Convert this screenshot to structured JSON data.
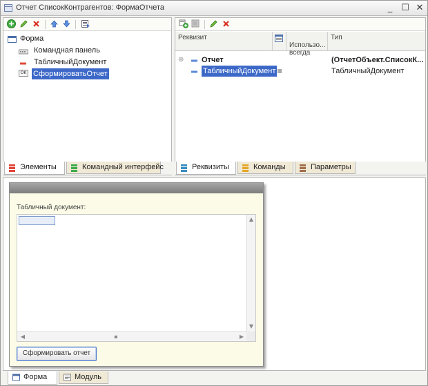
{
  "window": {
    "title": "Отчет СписокКонтрагентов: ФормаОтчета",
    "minimize_glyph": "_",
    "maximize_glyph": "☐",
    "close_glyph": "✕"
  },
  "left_pane": {
    "toolbar_icons": [
      "add-icon",
      "edit-icon",
      "delete-icon",
      "move-up-icon",
      "move-down-icon",
      "properties-icon"
    ],
    "tree": [
      {
        "label": "Форма",
        "icon": "form-icon",
        "selected": false
      },
      {
        "label": "Командная панель",
        "icon": "command-panel-icon",
        "selected": false
      },
      {
        "label": "ТабличныйДокумент",
        "icon": "spreadsheet-field-icon",
        "selected": false
      },
      {
        "label": "СформироватьОтчет",
        "icon": "ok-button-icon",
        "selected": true
      }
    ],
    "ok_badge": "OK",
    "tabs": [
      {
        "label": "Элементы",
        "active": true
      },
      {
        "label": "Командный интерфейс",
        "active": false
      }
    ]
  },
  "right_pane": {
    "toolbar_icons": [
      "add-attribute-icon",
      "add-column-icon",
      "edit-icon",
      "delete-icon"
    ],
    "columns": {
      "attribute": "Реквизит",
      "used_always": "Использо...\nвсегда",
      "type": "Тип"
    },
    "rows": [
      {
        "expander": "⊕",
        "name": "Отчет",
        "type": "(ОтчетОбъект.СписокК...",
        "bold": true,
        "selected": false
      },
      {
        "expander": "",
        "name": "ТабличныйДокумент",
        "type": "ТабличныйДокумент",
        "bold": false,
        "selected": true
      }
    ],
    "tabs": [
      {
        "label": "Реквизиты",
        "active": true
      },
      {
        "label": "Команды",
        "active": false
      },
      {
        "label": "Параметры",
        "active": false
      }
    ]
  },
  "preview": {
    "field_label": "Табличный документ:",
    "button_label": "Сформировать отчет"
  },
  "bottom_tabs": [
    {
      "label": "Форма",
      "active": true
    },
    {
      "label": "Модуль",
      "active": false
    }
  ],
  "colors": {
    "selection": "#3c68c8",
    "tab_inactive": "#efe9d6",
    "form_background": "#fbfbe7"
  }
}
